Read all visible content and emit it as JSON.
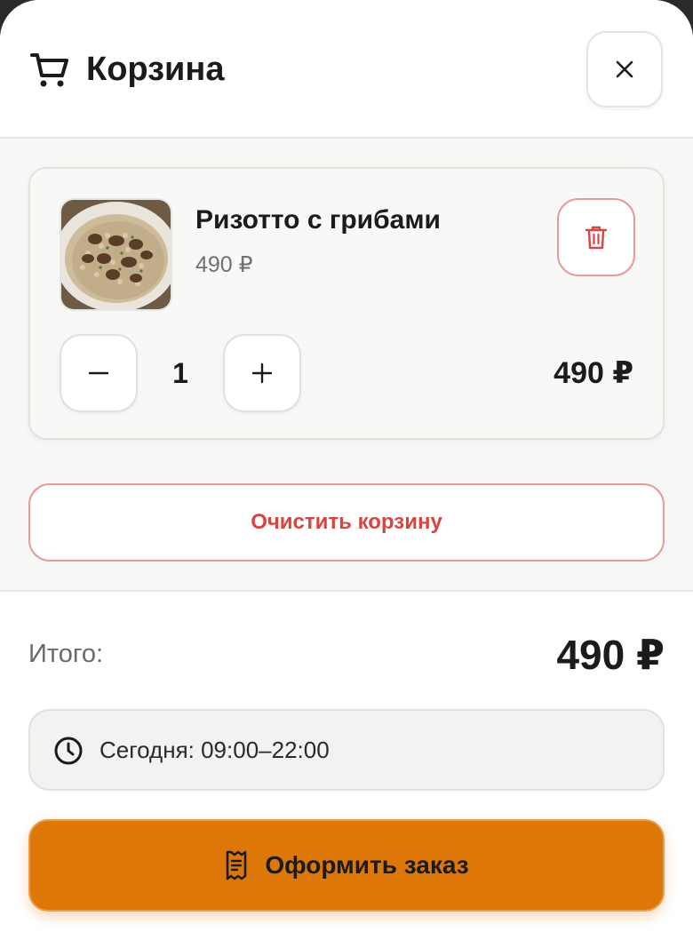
{
  "header": {
    "title": "Корзина",
    "cart_icon": "cart-icon",
    "close_icon": "close-icon"
  },
  "cart": {
    "items": [
      {
        "name": "Ризотто с грибами",
        "unit_price": "490 ₽",
        "quantity": "1",
        "line_total": "490 ₽",
        "image": "mushroom-risotto-photo",
        "delete_icon": "trash-icon"
      }
    ],
    "clear_label": "Очистить корзину"
  },
  "summary": {
    "total_label": "Итого:",
    "total_value": "490 ₽",
    "hours_icon": "clock-icon",
    "hours_text": "Сегодня: 09:00–22:00",
    "checkout_label": "Оформить заказ",
    "checkout_icon": "receipt-icon"
  },
  "colors": {
    "accent": "#dd7708",
    "danger": "#d9443f",
    "danger_border": "#e79b97"
  }
}
